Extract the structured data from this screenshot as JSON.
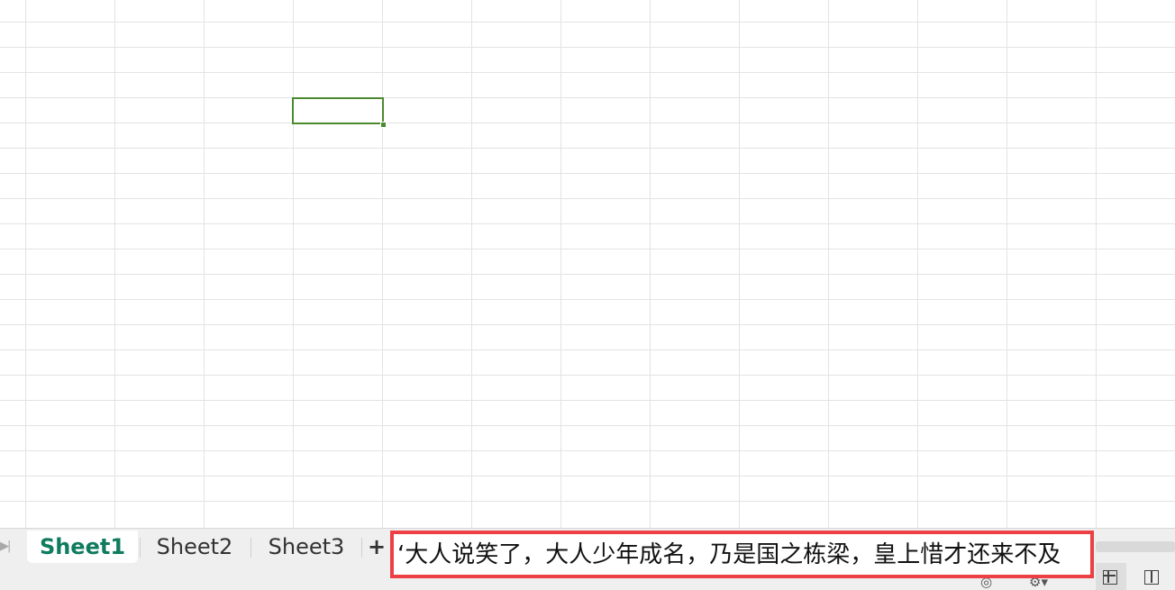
{
  "sheet_tabs": [
    {
      "label": "Sheet1",
      "active": true
    },
    {
      "label": "Sheet2",
      "active": false
    },
    {
      "label": "Sheet3",
      "active": false
    }
  ],
  "add_sheet_label": "+",
  "nav_last_icon": "nav-last-sheet-icon",
  "callout_text": "‘大人说笑了，大人少年成名，乃是国之栋梁，皇上惜才还来不及",
  "colors": {
    "active_tab_text": "#0f7b5f",
    "selection_border": "#4c8a2f",
    "callout_border": "#ec4044",
    "gridline": "#e3e3e3"
  },
  "icons": {
    "status_eye": "eye-icon",
    "status_settings": "settings-icon",
    "normal_view": "normal-view-icon",
    "page_layout_view": "page-layout-view-icon"
  }
}
